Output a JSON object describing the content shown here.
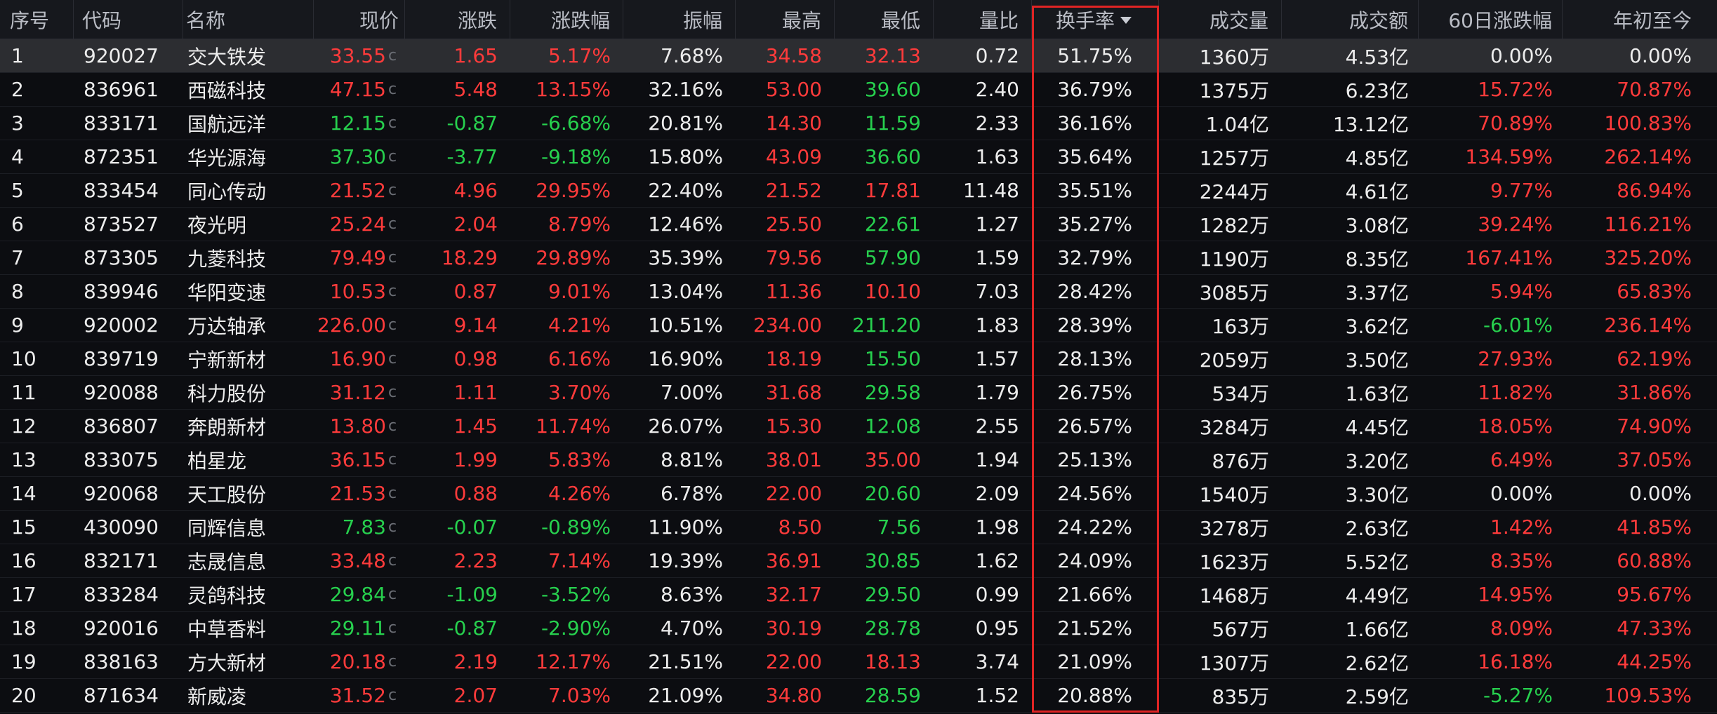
{
  "headers": {
    "index": "序号",
    "code": "代码",
    "name": "名称",
    "price": "现价",
    "change": "涨跌",
    "pct": "涨跌幅",
    "amplitude": "振幅",
    "high": "最高",
    "low": "最低",
    "volume_ratio": "量比",
    "turnover": "换手率",
    "volume": "成交量",
    "amount": "成交额",
    "chg60": "60日涨跌幅",
    "ytd": "年初至今"
  },
  "sort": {
    "column": "turnover",
    "direction": "desc",
    "icon": "triangle-down-icon"
  },
  "price_suffix": "c",
  "colors": {
    "up": "#ff3b3b",
    "down": "#27d04e",
    "flat": "#ececec",
    "highlight": "#e02424"
  },
  "rows": [
    {
      "index": "1",
      "code": "920027",
      "name": "交大铁发",
      "price": "33.55",
      "change": "1.65",
      "pct": "5.17%",
      "amplitude": "7.68%",
      "high": "34.58",
      "low": "32.13",
      "volume_ratio": "0.72",
      "turnover": "51.75%",
      "volume": "1360万",
      "amount": "4.53亿",
      "chg60": "0.00%",
      "ytd": "0.00%",
      "price_color": "red",
      "change_color": "red",
      "pct_color": "red",
      "high_color": "red",
      "low_color": "red",
      "chg60_color": "white",
      "ytd_color": "white"
    },
    {
      "index": "2",
      "code": "836961",
      "name": "西磁科技",
      "price": "47.15",
      "change": "5.48",
      "pct": "13.15%",
      "amplitude": "32.16%",
      "high": "53.00",
      "low": "39.60",
      "volume_ratio": "2.40",
      "turnover": "36.79%",
      "volume": "1375万",
      "amount": "6.23亿",
      "chg60": "15.72%",
      "ytd": "70.87%",
      "price_color": "red",
      "change_color": "red",
      "pct_color": "red",
      "high_color": "red",
      "low_color": "green",
      "chg60_color": "red",
      "ytd_color": "red"
    },
    {
      "index": "3",
      "code": "833171",
      "name": "国航远洋",
      "price": "12.15",
      "change": "-0.87",
      "pct": "-6.68%",
      "amplitude": "20.81%",
      "high": "14.30",
      "low": "11.59",
      "volume_ratio": "2.33",
      "turnover": "36.16%",
      "volume": "1.04亿",
      "amount": "13.12亿",
      "chg60": "70.89%",
      "ytd": "100.83%",
      "price_color": "green",
      "change_color": "green",
      "pct_color": "green",
      "high_color": "red",
      "low_color": "green",
      "chg60_color": "red",
      "ytd_color": "red"
    },
    {
      "index": "4",
      "code": "872351",
      "name": "华光源海",
      "price": "37.30",
      "change": "-3.77",
      "pct": "-9.18%",
      "amplitude": "15.80%",
      "high": "43.09",
      "low": "36.60",
      "volume_ratio": "1.63",
      "turnover": "35.64%",
      "volume": "1257万",
      "amount": "4.85亿",
      "chg60": "134.59%",
      "ytd": "262.14%",
      "price_color": "green",
      "change_color": "green",
      "pct_color": "green",
      "high_color": "red",
      "low_color": "green",
      "chg60_color": "red",
      "ytd_color": "red"
    },
    {
      "index": "5",
      "code": "833454",
      "name": "同心传动",
      "price": "21.52",
      "change": "4.96",
      "pct": "29.95%",
      "amplitude": "22.40%",
      "high": "21.52",
      "low": "17.81",
      "volume_ratio": "11.48",
      "turnover": "35.51%",
      "volume": "2244万",
      "amount": "4.61亿",
      "chg60": "9.77%",
      "ytd": "86.94%",
      "price_color": "red",
      "change_color": "red",
      "pct_color": "red",
      "high_color": "red",
      "low_color": "red",
      "chg60_color": "red",
      "ytd_color": "red"
    },
    {
      "index": "6",
      "code": "873527",
      "name": "夜光明",
      "price": "25.24",
      "change": "2.04",
      "pct": "8.79%",
      "amplitude": "12.46%",
      "high": "25.50",
      "low": "22.61",
      "volume_ratio": "1.27",
      "turnover": "35.27%",
      "volume": "1282万",
      "amount": "3.08亿",
      "chg60": "39.24%",
      "ytd": "116.21%",
      "price_color": "red",
      "change_color": "red",
      "pct_color": "red",
      "high_color": "red",
      "low_color": "green",
      "chg60_color": "red",
      "ytd_color": "red"
    },
    {
      "index": "7",
      "code": "873305",
      "name": "九菱科技",
      "price": "79.49",
      "change": "18.29",
      "pct": "29.89%",
      "amplitude": "35.39%",
      "high": "79.56",
      "low": "57.90",
      "volume_ratio": "1.59",
      "turnover": "32.79%",
      "volume": "1190万",
      "amount": "8.35亿",
      "chg60": "167.41%",
      "ytd": "325.20%",
      "price_color": "red",
      "change_color": "red",
      "pct_color": "red",
      "high_color": "red",
      "low_color": "green",
      "chg60_color": "red",
      "ytd_color": "red"
    },
    {
      "index": "8",
      "code": "839946",
      "name": "华阳变速",
      "price": "10.53",
      "change": "0.87",
      "pct": "9.01%",
      "amplitude": "13.04%",
      "high": "11.36",
      "low": "10.10",
      "volume_ratio": "7.03",
      "turnover": "28.42%",
      "volume": "3085万",
      "amount": "3.37亿",
      "chg60": "5.94%",
      "ytd": "65.83%",
      "price_color": "red",
      "change_color": "red",
      "pct_color": "red",
      "high_color": "red",
      "low_color": "red",
      "chg60_color": "red",
      "ytd_color": "red"
    },
    {
      "index": "9",
      "code": "920002",
      "name": "万达轴承",
      "price": "226.00",
      "change": "9.14",
      "pct": "4.21%",
      "amplitude": "10.51%",
      "high": "234.00",
      "low": "211.20",
      "volume_ratio": "1.83",
      "turnover": "28.39%",
      "volume": "163万",
      "amount": "3.62亿",
      "chg60": "-6.01%",
      "ytd": "236.14%",
      "price_color": "red",
      "change_color": "red",
      "pct_color": "red",
      "high_color": "red",
      "low_color": "green",
      "chg60_color": "green",
      "ytd_color": "red"
    },
    {
      "index": "10",
      "code": "839719",
      "name": "宁新新材",
      "price": "16.90",
      "change": "0.98",
      "pct": "6.16%",
      "amplitude": "16.90%",
      "high": "18.19",
      "low": "15.50",
      "volume_ratio": "1.57",
      "turnover": "28.13%",
      "volume": "2059万",
      "amount": "3.50亿",
      "chg60": "27.93%",
      "ytd": "62.19%",
      "price_color": "red",
      "change_color": "red",
      "pct_color": "red",
      "high_color": "red",
      "low_color": "green",
      "chg60_color": "red",
      "ytd_color": "red"
    },
    {
      "index": "11",
      "code": "920088",
      "name": "科力股份",
      "price": "31.12",
      "change": "1.11",
      "pct": "3.70%",
      "amplitude": "7.00%",
      "high": "31.68",
      "low": "29.58",
      "volume_ratio": "1.79",
      "turnover": "26.75%",
      "volume": "534万",
      "amount": "1.63亿",
      "chg60": "11.82%",
      "ytd": "31.86%",
      "price_color": "red",
      "change_color": "red",
      "pct_color": "red",
      "high_color": "red",
      "low_color": "green",
      "chg60_color": "red",
      "ytd_color": "red"
    },
    {
      "index": "12",
      "code": "836807",
      "name": "奔朗新材",
      "price": "13.80",
      "change": "1.45",
      "pct": "11.74%",
      "amplitude": "26.07%",
      "high": "15.30",
      "low": "12.08",
      "volume_ratio": "2.55",
      "turnover": "26.57%",
      "volume": "3284万",
      "amount": "4.45亿",
      "chg60": "18.05%",
      "ytd": "74.90%",
      "price_color": "red",
      "change_color": "red",
      "pct_color": "red",
      "high_color": "red",
      "low_color": "green",
      "chg60_color": "red",
      "ytd_color": "red"
    },
    {
      "index": "13",
      "code": "833075",
      "name": "柏星龙",
      "price": "36.15",
      "change": "1.99",
      "pct": "5.83%",
      "amplitude": "8.81%",
      "high": "38.01",
      "low": "35.00",
      "volume_ratio": "1.94",
      "turnover": "25.13%",
      "volume": "876万",
      "amount": "3.20亿",
      "chg60": "6.49%",
      "ytd": "37.05%",
      "price_color": "red",
      "change_color": "red",
      "pct_color": "red",
      "high_color": "red",
      "low_color": "red",
      "chg60_color": "red",
      "ytd_color": "red"
    },
    {
      "index": "14",
      "code": "920068",
      "name": "天工股份",
      "price": "21.53",
      "change": "0.88",
      "pct": "4.26%",
      "amplitude": "6.78%",
      "high": "22.00",
      "low": "20.60",
      "volume_ratio": "2.09",
      "turnover": "24.56%",
      "volume": "1540万",
      "amount": "3.30亿",
      "chg60": "0.00%",
      "ytd": "0.00%",
      "price_color": "red",
      "change_color": "red",
      "pct_color": "red",
      "high_color": "red",
      "low_color": "green",
      "chg60_color": "white",
      "ytd_color": "white"
    },
    {
      "index": "15",
      "code": "430090",
      "name": "同辉信息",
      "price": "7.83",
      "change": "-0.07",
      "pct": "-0.89%",
      "amplitude": "11.90%",
      "high": "8.50",
      "low": "7.56",
      "volume_ratio": "1.98",
      "turnover": "24.22%",
      "volume": "3278万",
      "amount": "2.63亿",
      "chg60": "1.42%",
      "ytd": "41.85%",
      "price_color": "green",
      "change_color": "green",
      "pct_color": "green",
      "high_color": "red",
      "low_color": "green",
      "chg60_color": "red",
      "ytd_color": "red"
    },
    {
      "index": "16",
      "code": "832171",
      "name": "志晟信息",
      "price": "33.48",
      "change": "2.23",
      "pct": "7.14%",
      "amplitude": "19.39%",
      "high": "36.91",
      "low": "30.85",
      "volume_ratio": "1.62",
      "turnover": "24.09%",
      "volume": "1623万",
      "amount": "5.52亿",
      "chg60": "8.35%",
      "ytd": "60.88%",
      "price_color": "red",
      "change_color": "red",
      "pct_color": "red",
      "high_color": "red",
      "low_color": "green",
      "chg60_color": "red",
      "ytd_color": "red"
    },
    {
      "index": "17",
      "code": "833284",
      "name": "灵鸽科技",
      "price": "29.84",
      "change": "-1.09",
      "pct": "-3.52%",
      "amplitude": "8.63%",
      "high": "32.17",
      "low": "29.50",
      "volume_ratio": "0.99",
      "turnover": "21.66%",
      "volume": "1468万",
      "amount": "4.49亿",
      "chg60": "14.95%",
      "ytd": "95.67%",
      "price_color": "green",
      "change_color": "green",
      "pct_color": "green",
      "high_color": "red",
      "low_color": "green",
      "chg60_color": "red",
      "ytd_color": "red"
    },
    {
      "index": "18",
      "code": "920016",
      "name": "中草香料",
      "price": "29.11",
      "change": "-0.87",
      "pct": "-2.90%",
      "amplitude": "4.70%",
      "high": "30.19",
      "low": "28.78",
      "volume_ratio": "0.95",
      "turnover": "21.52%",
      "volume": "567万",
      "amount": "1.66亿",
      "chg60": "8.09%",
      "ytd": "47.33%",
      "price_color": "green",
      "change_color": "green",
      "pct_color": "green",
      "high_color": "red",
      "low_color": "green",
      "chg60_color": "red",
      "ytd_color": "red"
    },
    {
      "index": "19",
      "code": "838163",
      "name": "方大新材",
      "price": "20.18",
      "change": "2.19",
      "pct": "12.17%",
      "amplitude": "21.51%",
      "high": "22.00",
      "low": "18.13",
      "volume_ratio": "3.74",
      "turnover": "21.09%",
      "volume": "1307万",
      "amount": "2.62亿",
      "chg60": "16.18%",
      "ytd": "44.25%",
      "price_color": "red",
      "change_color": "red",
      "pct_color": "red",
      "high_color": "red",
      "low_color": "red",
      "chg60_color": "red",
      "ytd_color": "red"
    },
    {
      "index": "20",
      "code": "871634",
      "name": "新威凌",
      "price": "31.52",
      "change": "2.07",
      "pct": "7.03%",
      "amplitude": "21.09%",
      "high": "34.80",
      "low": "28.59",
      "volume_ratio": "1.52",
      "turnover": "20.88%",
      "volume": "835万",
      "amount": "2.59亿",
      "chg60": "-5.27%",
      "ytd": "109.53%",
      "price_color": "red",
      "change_color": "red",
      "pct_color": "red",
      "high_color": "red",
      "low_color": "green",
      "chg60_color": "green",
      "ytd_color": "red"
    }
  ]
}
